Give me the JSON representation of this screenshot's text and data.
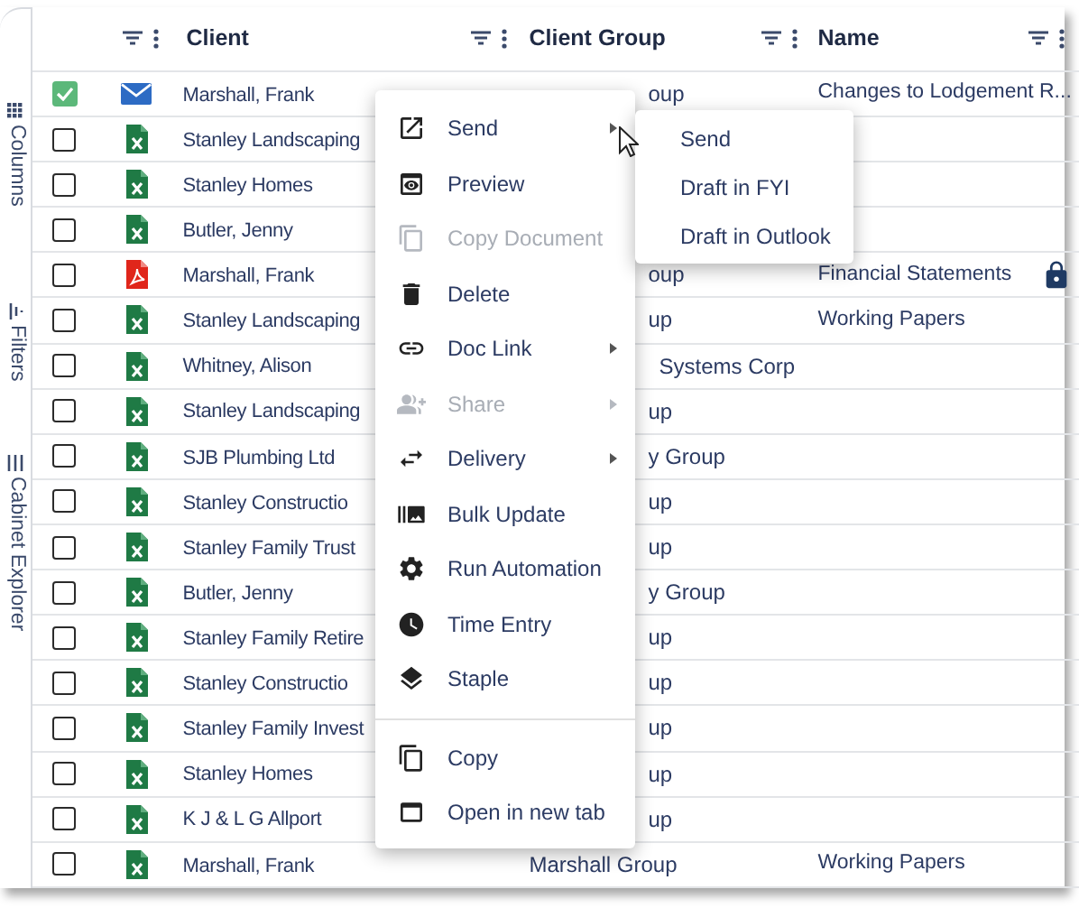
{
  "sidebar": {
    "items": [
      {
        "label": "Columns"
      },
      {
        "label": "Filters"
      },
      {
        "label": "Cabinet Explorer"
      }
    ]
  },
  "table": {
    "columns": [
      {
        "label": "Client"
      },
      {
        "label": "Client Group"
      },
      {
        "label": "Name"
      }
    ],
    "rows": [
      {
        "checked": true,
        "kind": "email",
        "client": "Marshall, Frank",
        "client_group": "oup",
        "name": "Changes to Lodgement R...",
        "locked": false
      },
      {
        "checked": false,
        "kind": "excel",
        "client": "Stanley Landscaping",
        "locked": false
      },
      {
        "checked": false,
        "kind": "excel",
        "client": "Stanley Homes",
        "locked": false
      },
      {
        "checked": false,
        "kind": "excel",
        "client": "Butler, Jenny",
        "locked": false
      },
      {
        "checked": false,
        "kind": "pdf",
        "client": "Marshall, Frank",
        "client_group": "oup",
        "name": "Financial Statements",
        "locked": true
      },
      {
        "checked": false,
        "kind": "excel",
        "client": "Stanley Landscaping",
        "client_group": "up",
        "name": "Working Papers",
        "locked": false
      },
      {
        "checked": false,
        "kind": "excel",
        "client": "Whitney, Alison",
        "client_group": "Systems Corp",
        "locked": false
      },
      {
        "checked": false,
        "kind": "excel",
        "client": "Stanley Landscaping",
        "client_group": "up",
        "locked": false
      },
      {
        "checked": false,
        "kind": "excel",
        "client": "SJB Plumbing Ltd",
        "client_group": "y Group",
        "locked": false
      },
      {
        "checked": false,
        "kind": "excel",
        "client": "Stanley Constructio",
        "client_group": "up",
        "locked": false
      },
      {
        "checked": false,
        "kind": "excel",
        "client": "Stanley Family Trust",
        "client_group": "up",
        "locked": false
      },
      {
        "checked": false,
        "kind": "excel",
        "client": "Butler, Jenny",
        "client_group": "y Group",
        "locked": false
      },
      {
        "checked": false,
        "kind": "excel",
        "client": "Stanley Family Retire",
        "client_group": "up",
        "locked": false
      },
      {
        "checked": false,
        "kind": "excel",
        "client": "Stanley Constructio",
        "client_group": "up",
        "locked": false
      },
      {
        "checked": false,
        "kind": "excel",
        "client": "Stanley Family Invest",
        "client_group": "up",
        "locked": false
      },
      {
        "checked": false,
        "kind": "excel",
        "client": "Stanley Homes",
        "client_group": "up",
        "locked": false
      },
      {
        "checked": false,
        "kind": "excel",
        "client": "K J & L G Allport",
        "client_group": "up",
        "locked": false
      },
      {
        "checked": false,
        "kind": "excel",
        "client": "Marshall, Frank",
        "client_group": "Marshall Group",
        "name": "Working Papers",
        "locked": false
      }
    ]
  },
  "menu": {
    "groups": [
      [
        {
          "label": "Send",
          "disabled": false,
          "submenu": true
        },
        {
          "label": "Preview",
          "disabled": false,
          "submenu": false
        },
        {
          "label": "Copy Document",
          "disabled": true,
          "submenu": false
        },
        {
          "label": "Delete",
          "disabled": false,
          "submenu": false
        },
        {
          "label": "Doc Link",
          "disabled": false,
          "submenu": true
        },
        {
          "label": "Share",
          "disabled": true,
          "submenu": true
        },
        {
          "label": "Delivery",
          "disabled": false,
          "submenu": true
        },
        {
          "label": "Bulk Update",
          "disabled": false,
          "submenu": false
        },
        {
          "label": "Run Automation",
          "disabled": false,
          "submenu": false
        },
        {
          "label": "Time Entry",
          "disabled": false,
          "submenu": false
        },
        {
          "label": "Staple",
          "disabled": false,
          "submenu": false
        }
      ],
      [
        {
          "label": "Copy",
          "disabled": false,
          "submenu": false
        },
        {
          "label": "Open in new tab",
          "disabled": false,
          "submenu": false
        }
      ]
    ]
  },
  "submenu": {
    "items": [
      "Send",
      "Draft in FYI",
      "Draft in Outlook"
    ]
  }
}
